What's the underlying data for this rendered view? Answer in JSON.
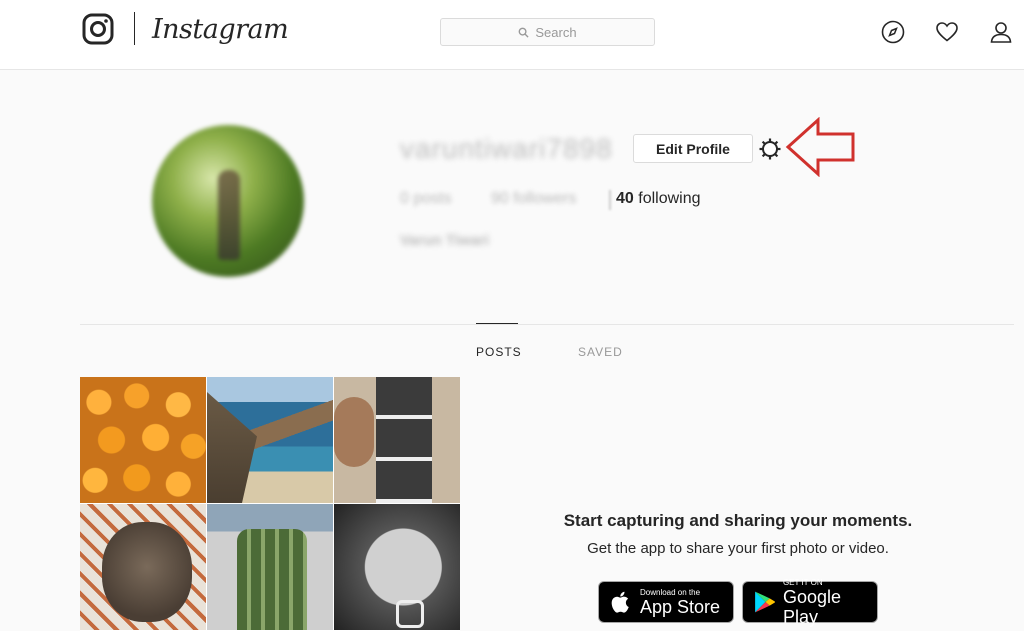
{
  "nav": {
    "wordmark": "Instagram",
    "search_placeholder": "Search",
    "icons": [
      "instagram-glyph-icon",
      "explore-compass-icon",
      "heart-icon",
      "profile-icon"
    ]
  },
  "profile": {
    "username": "varuntiwari7898",
    "edit_button": "Edit Profile",
    "stats": {
      "posts": "0 posts",
      "followers": "90 followers",
      "following_count": "40",
      "following_label": "following"
    },
    "full_name": "Varun Tiwari"
  },
  "tabs": [
    {
      "label": "POSTS",
      "active": true
    },
    {
      "label": "SAVED",
      "active": false
    }
  ],
  "promo": {
    "title": "Start capturing and sharing your moments.",
    "subtitle": "Get the app to share your first photo or video.",
    "app_store": {
      "small": "Download on the",
      "big": "App Store"
    },
    "google_play": {
      "small": "GET IT ON",
      "big": "Google Play"
    }
  },
  "colors": {
    "accent_red": "#d0312d",
    "text": "#262626",
    "muted": "#999999",
    "background": "#fafafa"
  }
}
